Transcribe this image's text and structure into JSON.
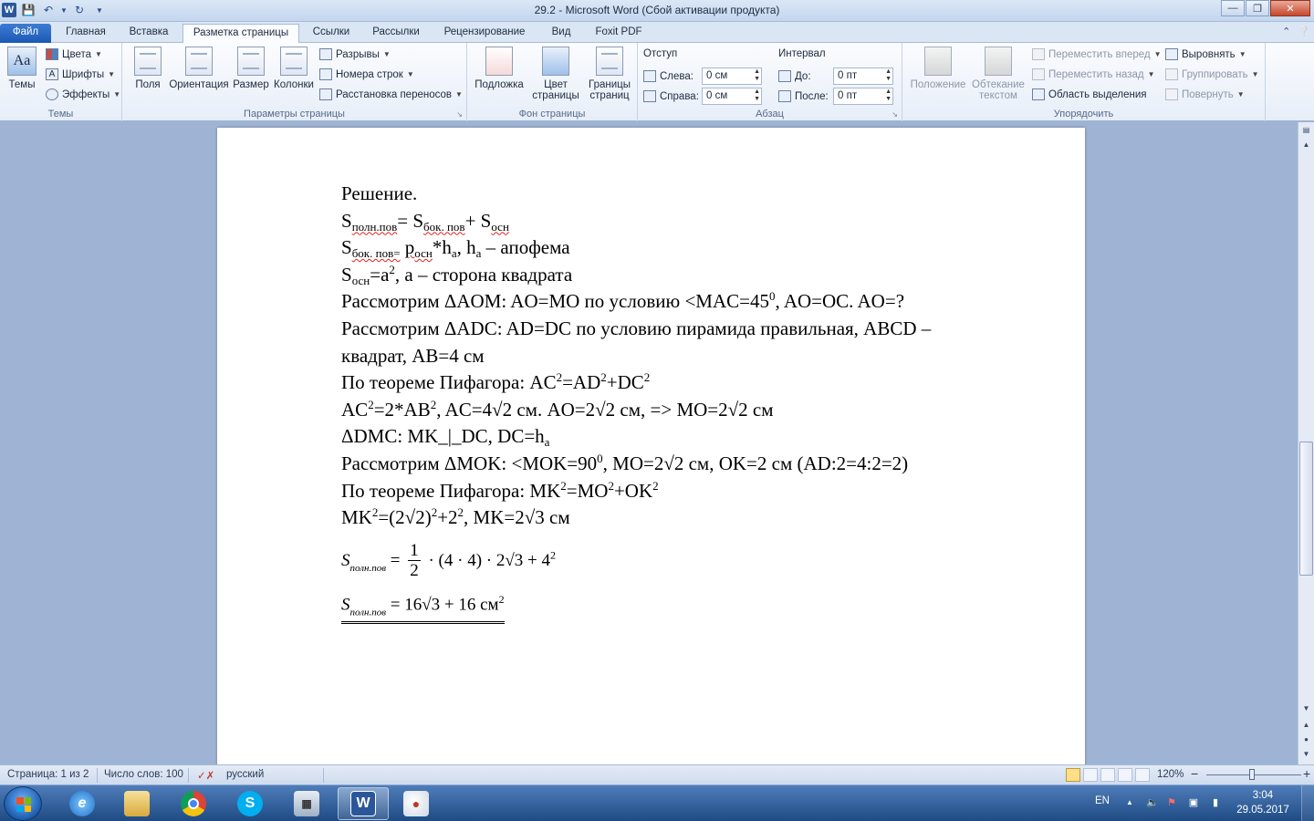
{
  "window": {
    "title": "29.2 - Microsoft Word (Сбой активации продукта)",
    "app_icon_letter": "W"
  },
  "tabs": [
    {
      "label": "Файл"
    },
    {
      "label": "Главная"
    },
    {
      "label": "Вставка"
    },
    {
      "label": "Разметка страницы"
    },
    {
      "label": "Ссылки"
    },
    {
      "label": "Рассылки"
    },
    {
      "label": "Рецензирование"
    },
    {
      "label": "Вид"
    },
    {
      "label": "Foxit PDF"
    }
  ],
  "ribbon": {
    "themes": {
      "label": "Темы",
      "big_button": "Темы",
      "colors": "Цвета",
      "fonts": "Шрифты",
      "effects": "Эффекты"
    },
    "page_setup": {
      "label": "Параметры страницы",
      "margins": "Поля",
      "orientation": "Ориентация",
      "size": "Размер",
      "columns": "Колонки",
      "breaks": "Разрывы",
      "line_numbers": "Номера строк",
      "hyphenation": "Расстановка переносов"
    },
    "page_background": {
      "label": "Фон страницы",
      "watermark": "Подложка",
      "page_color_1": "Цвет",
      "page_color_2": "страницы",
      "page_borders_1": "Границы",
      "page_borders_2": "страниц"
    },
    "paragraph": {
      "label": "Абзац",
      "indent_title": "Отступ",
      "left_label": "Слева:",
      "left_value": "0 см",
      "right_label": "Справа:",
      "right_value": "0 см",
      "spacing_title": "Интервал",
      "before_label": "До:",
      "before_value": "0 пт",
      "after_label": "После:",
      "after_value": "0 пт"
    },
    "arrange": {
      "label": "Упорядочить",
      "position": "Положение",
      "wrap_1": "Обтекание",
      "wrap_2": "текстом",
      "bring_forward": "Переместить вперед",
      "send_backward": "Переместить назад",
      "selection_pane": "Область выделения",
      "align": "Выровнять",
      "group": "Группировать",
      "rotate": "Повернуть"
    }
  },
  "document": {
    "l1": "Решение.",
    "l2": {
      "a": "S",
      "a_sub": "полн.пов",
      "b": "= S",
      "b_sub": "бок. пов",
      "c": "+ S",
      "c_sub": "осн"
    },
    "l3": {
      "a": "S",
      "a_sub": "бок. пов=",
      "b": "p",
      "b_sub": "осн",
      "c": "*h",
      "c_sub": "a",
      "d": ", h",
      "d_sub": "a",
      "e": " – апофема"
    },
    "l4": {
      "a": "S",
      "a_sub": "осн",
      "b": "=a",
      "b_sup": "2",
      "c": ", a – сторона квадрата"
    },
    "l5": {
      "a": "Рассмотрим ΔAOM: AO=MO по условию <MAC=45",
      "a_sup": "0",
      "b": ", AO=OC.  AO=?"
    },
    "l6": "Рассмотрим ΔADC: AD=DC по условию пирамида правильная, ABCD –",
    "l7": "квадрат,  AB=4 см",
    "l8": {
      "a": "По теореме Пифагора:  AC",
      "s1": "2",
      "b": "=AD",
      "s2": "2",
      "c": "+DC",
      "s3": "2"
    },
    "l9": {
      "a": "AC",
      "s1": "2",
      "b": "=2*AB",
      "s2": "2",
      "c": ", AC=4√2  см. AO=2√2  см, => MO=2√2  см"
    },
    "l10": {
      "a": "ΔDMC: MK_|_DC, DC=h",
      "a_sub": "a"
    },
    "l11": {
      "a": "Рассмотрим ΔMOK: <MOK=90",
      "a_sup": "0",
      "b": ", MO=2√2  см, OK=2 см (AD:2=4:2=2)"
    },
    "l12": {
      "a": "По теореме Пифагора:  MK",
      "s1": "2",
      "b": "=MO",
      "s2": "2",
      "c": "+OK",
      "s3": "2"
    },
    "l13": {
      "a": "MK",
      "s1": "2",
      "b": "=(2√2)",
      "s2": "2",
      "c": "+2",
      "s3": "2",
      "d": ",  MK=2√3 см"
    },
    "f1": {
      "s": "S",
      "sub": "полн.пов",
      "eq": "=",
      "num": "1",
      "den": "2",
      "rest": "· (4 · 4) · 2√3 + 4",
      "sup": "2"
    },
    "f2": {
      "s": "S",
      "sub": "полн.пов",
      "eq": "= 16√3 + 16 см",
      "sup": "2"
    }
  },
  "statusbar": {
    "page": "Страница: 1 из 2",
    "words": "Число слов: 100",
    "language": "русский",
    "zoom": "120%",
    "zoom_minus": "−",
    "zoom_plus": "+"
  },
  "taskbar": {
    "lang": "EN",
    "time": "3:04",
    "date": "29.05.2017"
  },
  "colors": {
    "ribbon_accent": "#2b579a",
    "file_tab": "#1b59b5",
    "taskbar": "#1f4b84"
  }
}
